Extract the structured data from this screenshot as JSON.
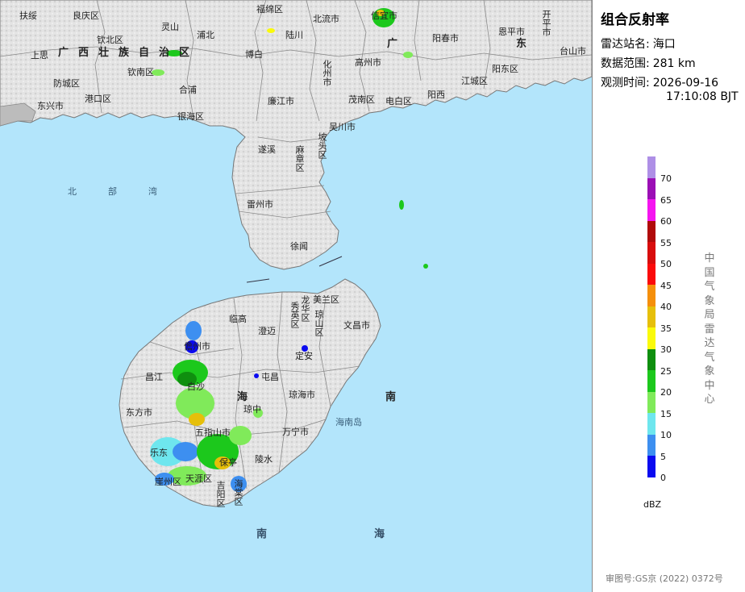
{
  "panel": {
    "title": "组合反射率",
    "station_label": "雷达站名:",
    "station_value": "海口",
    "range_label": "数据范围:",
    "range_value": "281 km",
    "time_label": "观测时间:",
    "time_date": "2026-09-16",
    "time_clock": "17:10:08 BJT",
    "unit": "dBZ",
    "agency": "中国气象局雷达气象中心",
    "footer": "审图号:GS京 (2022) 0372号"
  },
  "legend": [
    {
      "value": "70",
      "color": "#ae8fe6"
    },
    {
      "value": "65",
      "color": "#9b0fb5"
    },
    {
      "value": "60",
      "color": "#f515f0"
    },
    {
      "value": "55",
      "color": "#b00a0a"
    },
    {
      "value": "50",
      "color": "#d80d0d"
    },
    {
      "value": "45",
      "color": "#fb0a0a"
    },
    {
      "value": "40",
      "color": "#f58f0a"
    },
    {
      "value": "35",
      "color": "#e6bf0a"
    },
    {
      "value": "30",
      "color": "#fafa0a"
    },
    {
      "value": "25",
      "color": "#0f8f0f"
    },
    {
      "value": "20",
      "color": "#1cc81c"
    },
    {
      "value": "15",
      "color": "#80ea5a"
    },
    {
      "value": "10",
      "color": "#6ee6ee"
    },
    {
      "value": "5",
      "color": "#3d8ff0"
    },
    {
      "value": "0",
      "color": "#0a0af0"
    }
  ],
  "map": {
    "water_color": "#b3e5fb",
    "land_color": "#e9e9e9",
    "places": [
      "扶绥",
      "良庆区",
      "上思",
      "钦北区",
      "灵山",
      "浦北",
      "钦南区",
      "防城区",
      "东兴市",
      "港口区",
      "合浦",
      "银海区",
      "福绵区",
      "陆川",
      "博白",
      "北流市",
      "化州市",
      "高州市",
      "信宜市",
      "阳春市",
      "恩平市",
      "开平市",
      "台山市",
      "阳东区",
      "江城区",
      "阳西",
      "电白区",
      "茂南区",
      "廉江市",
      "遂溪",
      "麻章区",
      "坡头区",
      "吴川市",
      "雷州市",
      "徐闻",
      "临高",
      "澄迈",
      "美兰区",
      "秀英区",
      "琼山区",
      "龙华区",
      "定安",
      "文昌市",
      "儋州市",
      "昌江",
      "白沙",
      "屯昌",
      "琼海市",
      "琼中",
      "东方市",
      "五指山市",
      "万宁市",
      "乐东",
      "保亭",
      "陵水",
      "崖州区",
      "天涯区",
      "吉阳区",
      "海棠区",
      "海南岛"
    ],
    "regions": {
      "guangxi": "广西壮族自治区",
      "guangdong_a": "广",
      "guangdong_b": "东",
      "hainan_a": "海",
      "hainan_b": "南"
    },
    "seas": {
      "beibu_a": "北",
      "beibu_b": "部",
      "beibu_c": "湾",
      "south_a": "南",
      "south_b": "海"
    }
  }
}
